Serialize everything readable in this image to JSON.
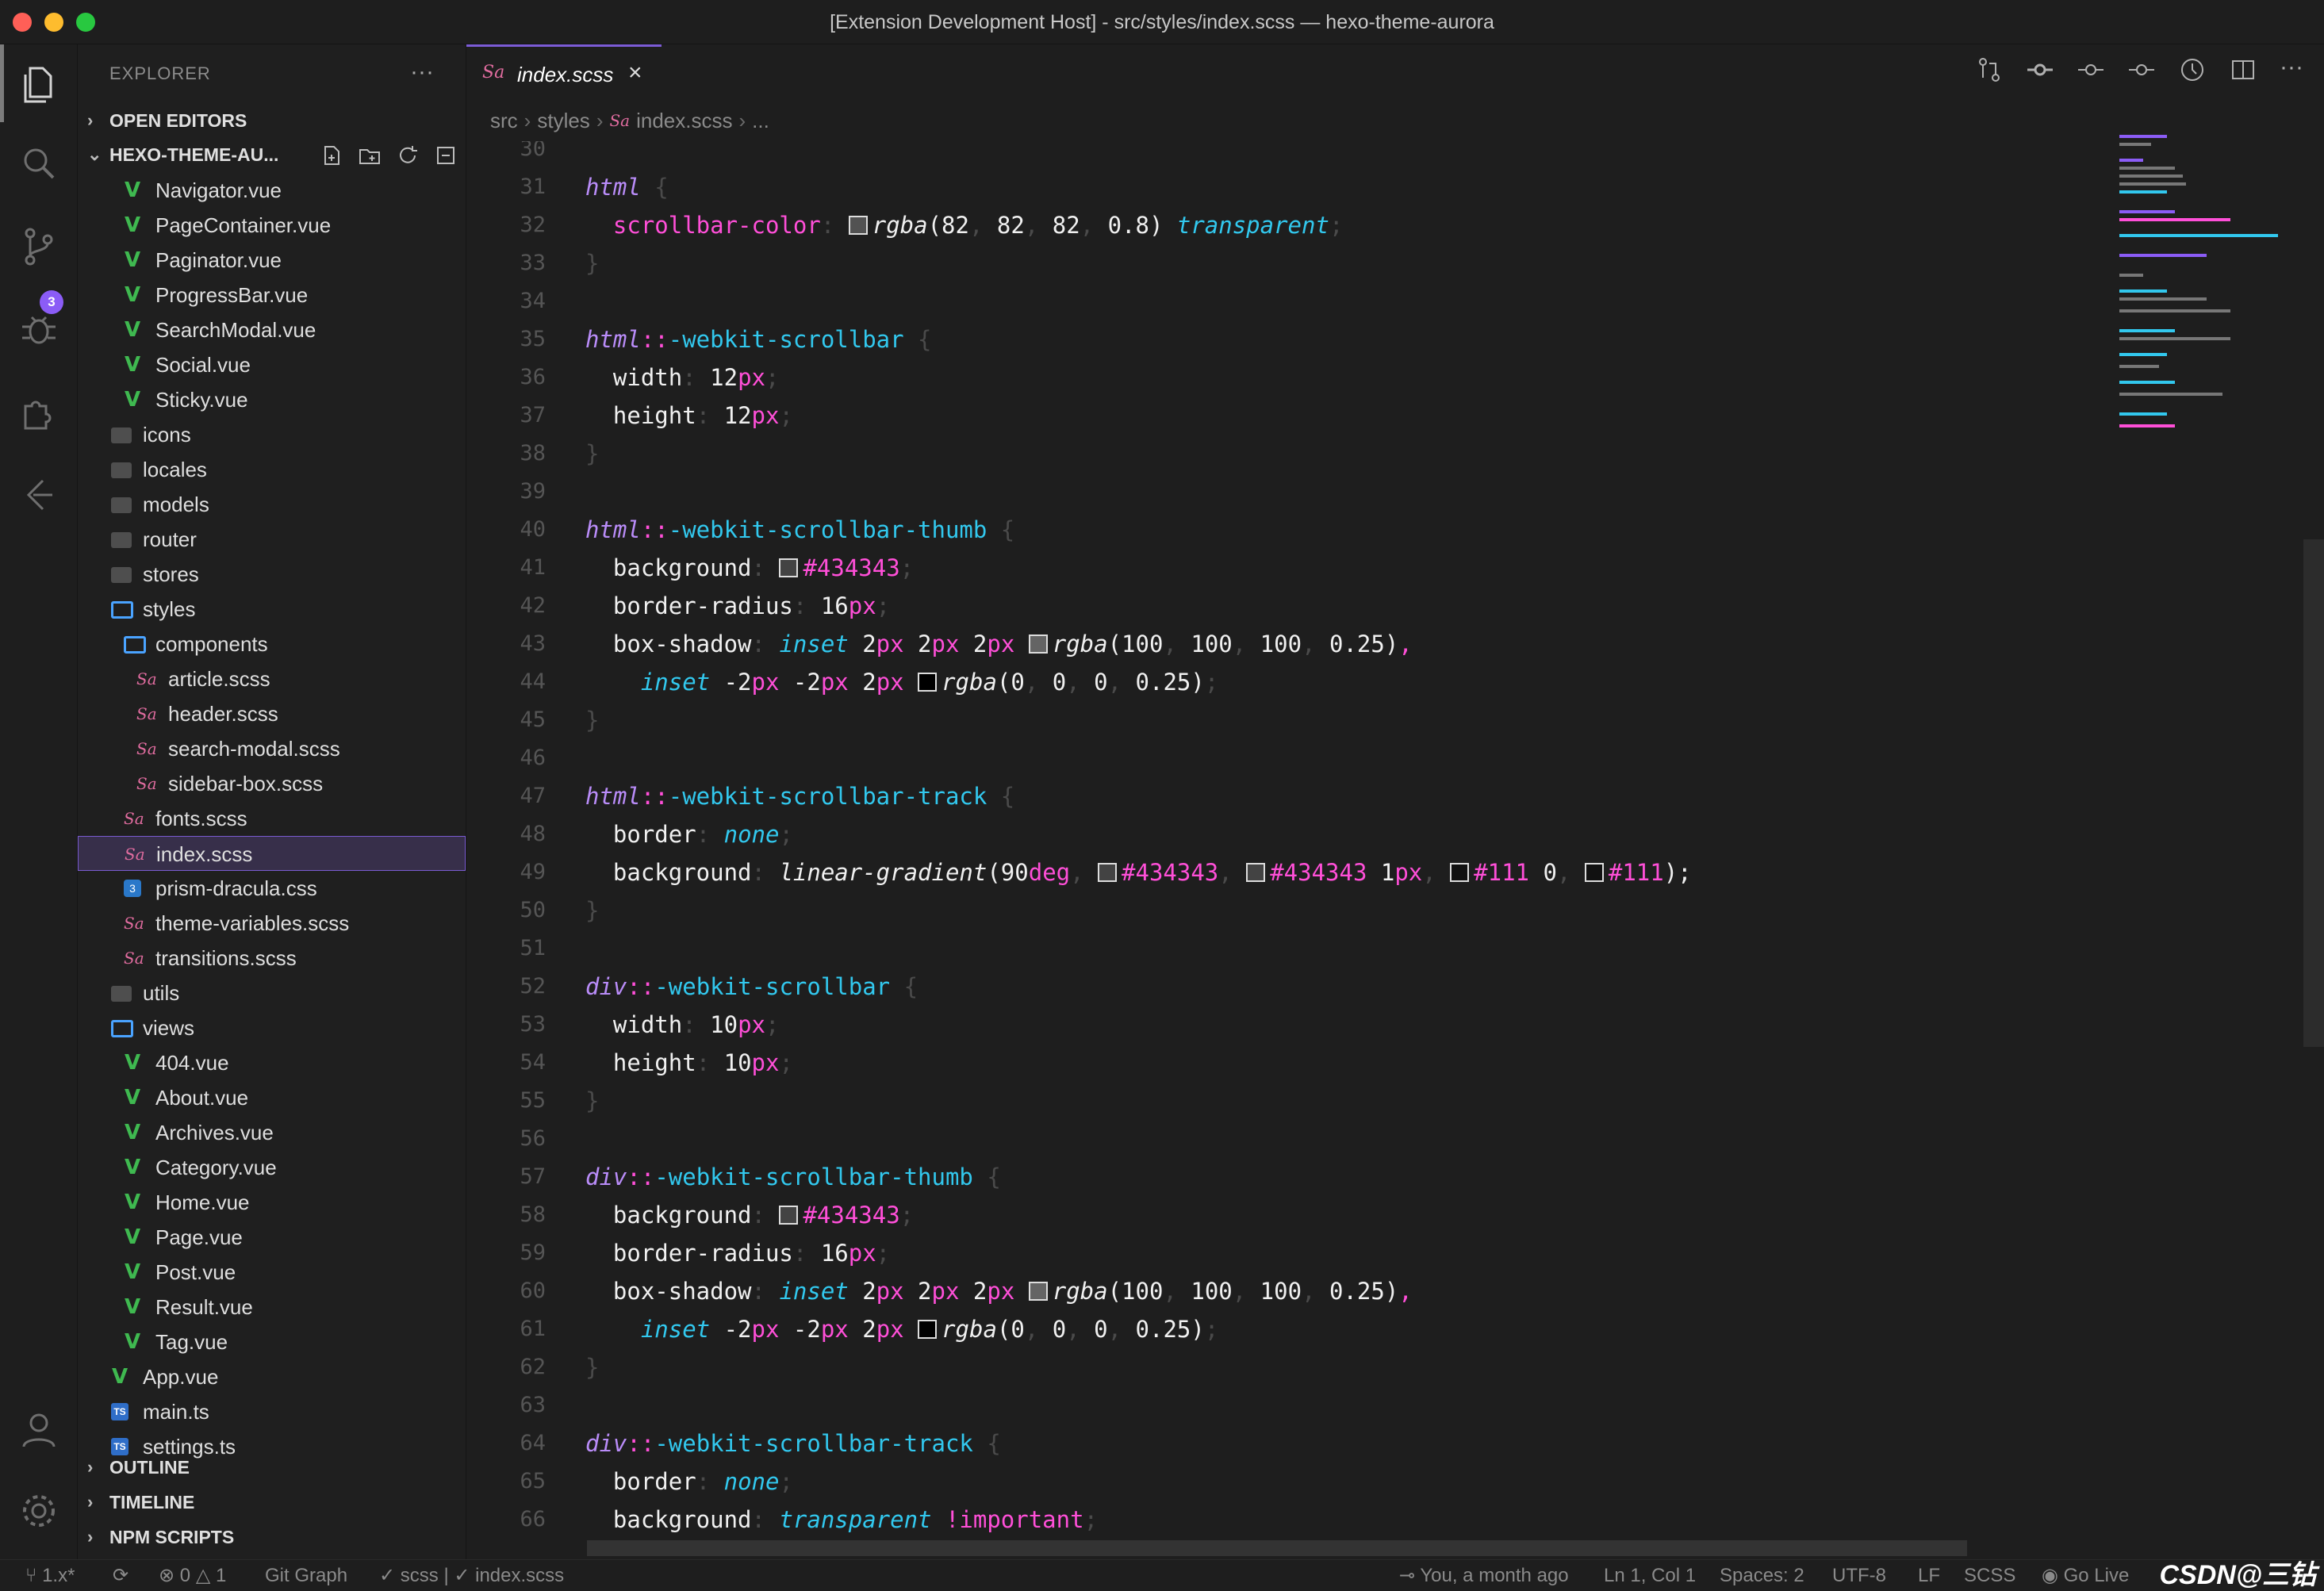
{
  "window": {
    "title": "[Extension Development Host] - src/styles/index.scss — hexo-theme-aurora",
    "traffic_colors": [
      "#ff5f57",
      "#febc2e",
      "#28c840"
    ]
  },
  "activity_bar": {
    "icons": [
      "files-icon",
      "search-icon",
      "source-control-icon",
      "debug-icon",
      "extensions-icon",
      "remote-icon"
    ],
    "scm_badge": "3",
    "bottom_icons": [
      "account-icon",
      "settings-gear-icon"
    ]
  },
  "explorer": {
    "title": "EXPLORER",
    "more": "···",
    "open_editors": "OPEN EDITORS",
    "project": "HEXO-THEME-AU...",
    "tree": [
      {
        "name": "Navigator.vue",
        "type": "vue",
        "indent": 1
      },
      {
        "name": "PageContainer.vue",
        "type": "vue",
        "indent": 1
      },
      {
        "name": "Paginator.vue",
        "type": "vue",
        "indent": 1
      },
      {
        "name": "ProgressBar.vue",
        "type": "vue",
        "indent": 1
      },
      {
        "name": "SearchModal.vue",
        "type": "vue",
        "indent": 1
      },
      {
        "name": "Social.vue",
        "type": "vue",
        "indent": 1
      },
      {
        "name": "Sticky.vue",
        "type": "vue",
        "indent": 1
      },
      {
        "name": "icons",
        "type": "folder",
        "indent": 0
      },
      {
        "name": "locales",
        "type": "folder",
        "indent": 0
      },
      {
        "name": "models",
        "type": "folder",
        "indent": 0
      },
      {
        "name": "router",
        "type": "folder",
        "indent": 0
      },
      {
        "name": "stores",
        "type": "folder",
        "indent": 0
      },
      {
        "name": "styles",
        "type": "folder-open",
        "indent": 0
      },
      {
        "name": "components",
        "type": "folder-open",
        "indent": 1
      },
      {
        "name": "article.scss",
        "type": "sass",
        "indent": 2
      },
      {
        "name": "header.scss",
        "type": "sass",
        "indent": 2
      },
      {
        "name": "search-modal.scss",
        "type": "sass",
        "indent": 2
      },
      {
        "name": "sidebar-box.scss",
        "type": "sass",
        "indent": 2
      },
      {
        "name": "fonts.scss",
        "type": "sass",
        "indent": 1
      },
      {
        "name": "index.scss",
        "type": "sass",
        "indent": 1,
        "selected": true
      },
      {
        "name": "prism-dracula.css",
        "type": "css",
        "indent": 1
      },
      {
        "name": "theme-variables.scss",
        "type": "sass",
        "indent": 1
      },
      {
        "name": "transitions.scss",
        "type": "sass",
        "indent": 1
      },
      {
        "name": "utils",
        "type": "folder",
        "indent": 0
      },
      {
        "name": "views",
        "type": "folder-open",
        "indent": 0
      },
      {
        "name": "404.vue",
        "type": "vue",
        "indent": 1
      },
      {
        "name": "About.vue",
        "type": "vue",
        "indent": 1
      },
      {
        "name": "Archives.vue",
        "type": "vue",
        "indent": 1
      },
      {
        "name": "Category.vue",
        "type": "vue",
        "indent": 1
      },
      {
        "name": "Home.vue",
        "type": "vue",
        "indent": 1
      },
      {
        "name": "Page.vue",
        "type": "vue",
        "indent": 1
      },
      {
        "name": "Post.vue",
        "type": "vue",
        "indent": 1
      },
      {
        "name": "Result.vue",
        "type": "vue",
        "indent": 1
      },
      {
        "name": "Tag.vue",
        "type": "vue",
        "indent": 1
      },
      {
        "name": "App.vue",
        "type": "vue",
        "indent": 0
      },
      {
        "name": "main.ts",
        "type": "ts",
        "indent": 0
      },
      {
        "name": "settings.ts",
        "type": "ts",
        "indent": 0
      }
    ],
    "outline": "OUTLINE",
    "timeline": "TIMELINE",
    "npm_scripts": "NPM SCRIPTS"
  },
  "tab": {
    "label": "index.scss",
    "close": "×"
  },
  "breadcrumb": [
    "src",
    "styles",
    "index.scss",
    "..."
  ],
  "editor": {
    "lines": [
      {
        "n": "30",
        "tokens": []
      },
      {
        "n": "31",
        "tokens": [
          [
            "html",
            "sel"
          ],
          [
            " {",
            "punc"
          ]
        ]
      },
      {
        "n": "32",
        "tokens": [
          [
            "  scrollbar-color",
            "pink"
          ],
          [
            ": ",
            "punc"
          ],
          [
            "#swatch:#525252",
            "sw"
          ],
          [
            "rgba",
            "fn"
          ],
          [
            "(82",
            "num"
          ],
          [
            ", ",
            "punc"
          ],
          [
            "82",
            "num"
          ],
          [
            ", ",
            "punc"
          ],
          [
            "82",
            "num"
          ],
          [
            ", ",
            "punc"
          ],
          [
            "0.8)",
            "num"
          ],
          [
            " transparent",
            "cyan"
          ],
          [
            ";",
            "punc"
          ]
        ]
      },
      {
        "n": "33",
        "tokens": [
          [
            "}",
            "punc"
          ]
        ]
      },
      {
        "n": "34",
        "tokens": []
      },
      {
        "n": "35",
        "tokens": [
          [
            "html",
            "sel"
          ],
          [
            "::",
            "pink"
          ],
          [
            "-webkit-scrollbar",
            "pse"
          ],
          [
            " {",
            "punc"
          ]
        ]
      },
      {
        "n": "36",
        "tokens": [
          [
            "  width",
            "prop"
          ],
          [
            ": ",
            "punc"
          ],
          [
            "12",
            "num"
          ],
          [
            "px",
            "pink"
          ],
          [
            ";",
            "punc"
          ]
        ]
      },
      {
        "n": "37",
        "tokens": [
          [
            "  height",
            "prop"
          ],
          [
            ": ",
            "punc"
          ],
          [
            "12",
            "num"
          ],
          [
            "px",
            "pink"
          ],
          [
            ";",
            "punc"
          ]
        ]
      },
      {
        "n": "38",
        "tokens": [
          [
            "}",
            "punc"
          ]
        ]
      },
      {
        "n": "39",
        "tokens": []
      },
      {
        "n": "40",
        "tokens": [
          [
            "html",
            "sel"
          ],
          [
            "::",
            "pink"
          ],
          [
            "-webkit-scrollbar-thumb",
            "pse"
          ],
          [
            " {",
            "punc"
          ]
        ]
      },
      {
        "n": "41",
        "tokens": [
          [
            "  background",
            "prop"
          ],
          [
            ": ",
            "punc"
          ],
          [
            "#swatch:#434343",
            "sw"
          ],
          [
            "#434343",
            "pink"
          ],
          [
            ";",
            "punc"
          ]
        ]
      },
      {
        "n": "42",
        "tokens": [
          [
            "  border-radius",
            "prop"
          ],
          [
            ": ",
            "punc"
          ],
          [
            "16",
            "num"
          ],
          [
            "px",
            "pink"
          ],
          [
            ";",
            "punc"
          ]
        ]
      },
      {
        "n": "43",
        "tokens": [
          [
            "  box-shadow",
            "prop"
          ],
          [
            ": ",
            "punc"
          ],
          [
            "inset",
            "cyan"
          ],
          [
            " 2",
            "num"
          ],
          [
            "px",
            "pink"
          ],
          [
            " 2",
            "num"
          ],
          [
            "px",
            "pink"
          ],
          [
            " 2",
            "num"
          ],
          [
            "px",
            "pink"
          ],
          [
            " ",
            "punc"
          ],
          [
            "#swatch:#646464",
            "sw"
          ],
          [
            "rgba",
            "fn"
          ],
          [
            "(100",
            "num"
          ],
          [
            ", ",
            "punc"
          ],
          [
            "100",
            "num"
          ],
          [
            ", ",
            "punc"
          ],
          [
            "100",
            "num"
          ],
          [
            ", ",
            "punc"
          ],
          [
            "0.25)",
            "num"
          ],
          [
            ",",
            "pink"
          ]
        ]
      },
      {
        "n": "44",
        "tokens": [
          [
            "    inset",
            "cyan"
          ],
          [
            " -2",
            "num"
          ],
          [
            "px",
            "pink"
          ],
          [
            " -2",
            "num"
          ],
          [
            "px",
            "pink"
          ],
          [
            " 2",
            "num"
          ],
          [
            "px",
            "pink"
          ],
          [
            " ",
            "punc"
          ],
          [
            "#swatch:#000000",
            "sw"
          ],
          [
            "rgba",
            "fn"
          ],
          [
            "(0",
            "num"
          ],
          [
            ", ",
            "punc"
          ],
          [
            "0",
            "num"
          ],
          [
            ", ",
            "punc"
          ],
          [
            "0",
            "num"
          ],
          [
            ", ",
            "punc"
          ],
          [
            "0.25)",
            "num"
          ],
          [
            ";",
            "punc"
          ]
        ]
      },
      {
        "n": "45",
        "tokens": [
          [
            "}",
            "punc"
          ]
        ]
      },
      {
        "n": "46",
        "tokens": []
      },
      {
        "n": "47",
        "tokens": [
          [
            "html",
            "sel"
          ],
          [
            "::",
            "pink"
          ],
          [
            "-webkit-scrollbar-track",
            "pse"
          ],
          [
            " {",
            "punc"
          ]
        ]
      },
      {
        "n": "48",
        "tokens": [
          [
            "  border",
            "prop"
          ],
          [
            ": ",
            "punc"
          ],
          [
            "none",
            "cyan"
          ],
          [
            ";",
            "punc"
          ]
        ]
      },
      {
        "n": "49",
        "tokens": [
          [
            "  background",
            "prop"
          ],
          [
            ": ",
            "punc"
          ],
          [
            "linear-gradient",
            "fn"
          ],
          [
            "(90",
            "num"
          ],
          [
            "deg",
            "pink"
          ],
          [
            ", ",
            "punc"
          ],
          [
            "#swatch:#434343",
            "sw"
          ],
          [
            "#434343",
            "pink"
          ],
          [
            ", ",
            "punc"
          ],
          [
            "#swatch:#434343",
            "sw"
          ],
          [
            "#434343",
            "pink"
          ],
          [
            " 1",
            "num"
          ],
          [
            "px",
            "pink"
          ],
          [
            ", ",
            "punc"
          ],
          [
            "#swatch:#111111",
            "sw"
          ],
          [
            "#111",
            "pink"
          ],
          [
            " 0",
            "num"
          ],
          [
            ", ",
            "punc"
          ],
          [
            "#swatch:#111111",
            "sw"
          ],
          [
            "#111",
            "pink"
          ],
          [
            ");",
            "num"
          ]
        ]
      },
      {
        "n": "50",
        "tokens": [
          [
            "}",
            "punc"
          ]
        ]
      },
      {
        "n": "51",
        "tokens": []
      },
      {
        "n": "52",
        "tokens": [
          [
            "div",
            "sel"
          ],
          [
            "::",
            "pink"
          ],
          [
            "-webkit-scrollbar",
            "pse"
          ],
          [
            " {",
            "punc"
          ]
        ]
      },
      {
        "n": "53",
        "tokens": [
          [
            "  width",
            "prop"
          ],
          [
            ": ",
            "punc"
          ],
          [
            "10",
            "num"
          ],
          [
            "px",
            "pink"
          ],
          [
            ";",
            "punc"
          ]
        ]
      },
      {
        "n": "54",
        "tokens": [
          [
            "  height",
            "prop"
          ],
          [
            ": ",
            "punc"
          ],
          [
            "10",
            "num"
          ],
          [
            "px",
            "pink"
          ],
          [
            ";",
            "punc"
          ]
        ]
      },
      {
        "n": "55",
        "tokens": [
          [
            "}",
            "punc"
          ]
        ]
      },
      {
        "n": "56",
        "tokens": []
      },
      {
        "n": "57",
        "tokens": [
          [
            "div",
            "sel"
          ],
          [
            "::",
            "pink"
          ],
          [
            "-webkit-scrollbar-thumb",
            "pse"
          ],
          [
            " {",
            "punc"
          ]
        ]
      },
      {
        "n": "58",
        "tokens": [
          [
            "  background",
            "prop"
          ],
          [
            ": ",
            "punc"
          ],
          [
            "#swatch:#434343",
            "sw"
          ],
          [
            "#434343",
            "pink"
          ],
          [
            ";",
            "punc"
          ]
        ]
      },
      {
        "n": "59",
        "tokens": [
          [
            "  border-radius",
            "prop"
          ],
          [
            ": ",
            "punc"
          ],
          [
            "16",
            "num"
          ],
          [
            "px",
            "pink"
          ],
          [
            ";",
            "punc"
          ]
        ]
      },
      {
        "n": "60",
        "tokens": [
          [
            "  box-shadow",
            "prop"
          ],
          [
            ": ",
            "punc"
          ],
          [
            "inset",
            "cyan"
          ],
          [
            " 2",
            "num"
          ],
          [
            "px",
            "pink"
          ],
          [
            " 2",
            "num"
          ],
          [
            "px",
            "pink"
          ],
          [
            " 2",
            "num"
          ],
          [
            "px",
            "pink"
          ],
          [
            " ",
            "punc"
          ],
          [
            "#swatch:#646464",
            "sw"
          ],
          [
            "rgba",
            "fn"
          ],
          [
            "(100",
            "num"
          ],
          [
            ", ",
            "punc"
          ],
          [
            "100",
            "num"
          ],
          [
            ", ",
            "punc"
          ],
          [
            "100",
            "num"
          ],
          [
            ", ",
            "punc"
          ],
          [
            "0.25)",
            "num"
          ],
          [
            ",",
            "pink"
          ]
        ]
      },
      {
        "n": "61",
        "tokens": [
          [
            "    inset",
            "cyan"
          ],
          [
            " -2",
            "num"
          ],
          [
            "px",
            "pink"
          ],
          [
            " -2",
            "num"
          ],
          [
            "px",
            "pink"
          ],
          [
            " 2",
            "num"
          ],
          [
            "px",
            "pink"
          ],
          [
            " ",
            "punc"
          ],
          [
            "#swatch:#000000",
            "sw"
          ],
          [
            "rgba",
            "fn"
          ],
          [
            "(0",
            "num"
          ],
          [
            ", ",
            "punc"
          ],
          [
            "0",
            "num"
          ],
          [
            ", ",
            "punc"
          ],
          [
            "0",
            "num"
          ],
          [
            ", ",
            "punc"
          ],
          [
            "0.25)",
            "num"
          ],
          [
            ";",
            "punc"
          ]
        ]
      },
      {
        "n": "62",
        "tokens": [
          [
            "}",
            "punc"
          ]
        ]
      },
      {
        "n": "63",
        "tokens": []
      },
      {
        "n": "64",
        "tokens": [
          [
            "div",
            "sel"
          ],
          [
            "::",
            "pink"
          ],
          [
            "-webkit-scrollbar-track",
            "pse"
          ],
          [
            " {",
            "punc"
          ]
        ]
      },
      {
        "n": "65",
        "tokens": [
          [
            "  border",
            "prop"
          ],
          [
            ": ",
            "punc"
          ],
          [
            "none",
            "cyan"
          ],
          [
            ";",
            "punc"
          ]
        ]
      },
      {
        "n": "66",
        "tokens": [
          [
            "  background",
            "prop"
          ],
          [
            ": ",
            "punc"
          ],
          [
            "transparent",
            "cyan"
          ],
          [
            " !important",
            "pink"
          ],
          [
            ";",
            "punc"
          ]
        ]
      }
    ]
  },
  "status": {
    "branch": "1.x*",
    "errors": "0",
    "warnings": "1",
    "git_graph": "Git Graph",
    "scss_check": "scss | ✓ index.scss",
    "blame": "You, a month ago",
    "position": "Ln 1, Col 1",
    "spaces": "Spaces: 2",
    "encoding": "UTF-8",
    "eol": "LF",
    "language": "SCSS",
    "golive": "Go Live"
  },
  "watermark": "CSDN@三钻",
  "colors": {
    "accent": "#7c5cd6",
    "selector": "#b98cf8",
    "cyan": "#32c8ee",
    "pink": "#ff4fd8",
    "vue_green": "#3fb950",
    "sass_pink": "#e06c9f"
  }
}
